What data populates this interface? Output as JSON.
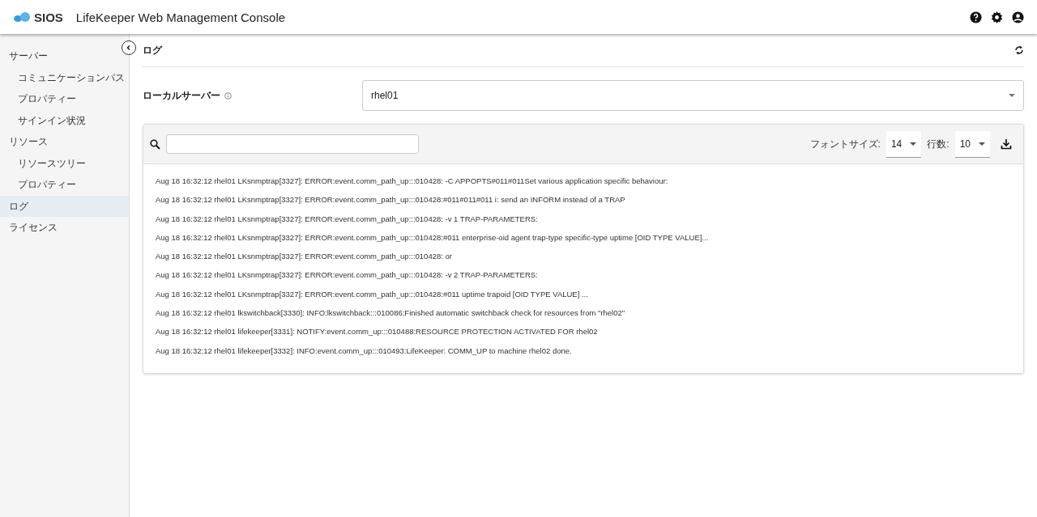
{
  "header": {
    "logo_text": "SIOS",
    "title": "LifeKeeper Web Management Console"
  },
  "sidebar": {
    "items": [
      {
        "label": "サーバー",
        "selected": false,
        "children": [
          {
            "label": "コミュニケーションパス",
            "selected": false
          },
          {
            "label": "プロパティー",
            "selected": false
          },
          {
            "label": "サインイン状況",
            "selected": false
          }
        ]
      },
      {
        "label": "リソース",
        "selected": false,
        "children": [
          {
            "label": "リソースツリー",
            "selected": false
          },
          {
            "label": "プロパティー",
            "selected": false
          }
        ]
      },
      {
        "label": "ログ",
        "selected": true
      },
      {
        "label": "ライセンス",
        "selected": false
      }
    ]
  },
  "page": {
    "title": "ログ",
    "server_label": "ローカルサーバー",
    "server_value": "rhel01"
  },
  "log_toolbar": {
    "font_size_label": "フォントサイズ:",
    "font_size": "14",
    "rows_label": "行数:",
    "rows": "10"
  },
  "log_lines": [
    "Aug 18 16:32:12 rhel01 LKsnmptrap[3327]: ERROR:event.comm_path_up:::010428: -C APPOPTS#011#011Set various application specific behaviour:",
    "Aug 18 16:32:12 rhel01 LKsnmptrap[3327]: ERROR:event.comm_path_up:::010428:#011#011#011 i: send an INFORM instead of a TRAP",
    "Aug 18 16:32:12 rhel01 LKsnmptrap[3327]: ERROR:event.comm_path_up:::010428: -v 1 TRAP-PARAMETERS:",
    "Aug 18 16:32:12 rhel01 LKsnmptrap[3327]: ERROR:event.comm_path_up:::010428:#011 enterprise-oid agent trap-type specific-type uptime [OID TYPE VALUE]...",
    "Aug 18 16:32:12 rhel01 LKsnmptrap[3327]: ERROR:event.comm_path_up:::010428: or",
    "Aug 18 16:32:12 rhel01 LKsnmptrap[3327]: ERROR:event.comm_path_up:::010428: -v 2 TRAP-PARAMETERS:",
    "Aug 18 16:32:12 rhel01 LKsnmptrap[3327]: ERROR:event.comm_path_up:::010428:#011 uptime trapoid [OID TYPE VALUE] ...",
    "Aug 18 16:32:12 rhel01 lkswitchback[3330]: INFO:lkswitchback:::010086:Finished automatic switchback check for resources from \"rhel02\"",
    "Aug 18 16:32:12 rhel01 lifekeeper[3331]: NOTIFY:event.comm_up:::010488:RESOURCE PROTECTION ACTIVATED FOR rhel02",
    "Aug 18 16:32:12 rhel01 lifekeeper[3332]: INFO:event.comm_up:::010493:LifeKeeper: COMM_UP to machine rhel02 done."
  ]
}
